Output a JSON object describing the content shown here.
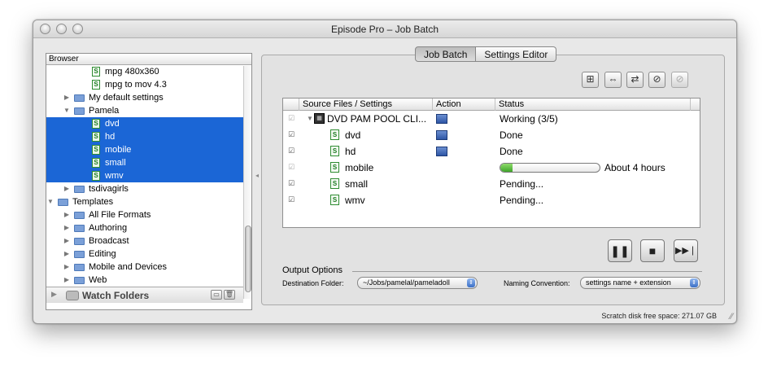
{
  "window": {
    "title": "Episode Pro – Job Batch"
  },
  "browser": {
    "header": "Browser",
    "items": [
      {
        "label": "mpg 480x360",
        "kind": "setting",
        "indent": 3,
        "selected": false
      },
      {
        "label": "mpg to mov 4.3",
        "kind": "setting",
        "indent": 3,
        "selected": false
      },
      {
        "label": "My default settings",
        "kind": "folder",
        "indent": 2,
        "open": false,
        "selected": false
      },
      {
        "label": "Pamela",
        "kind": "folder",
        "indent": 2,
        "open": true,
        "selected": false
      },
      {
        "label": "dvd",
        "kind": "setting",
        "indent": 3,
        "selected": true
      },
      {
        "label": "hd",
        "kind": "setting",
        "indent": 3,
        "selected": true
      },
      {
        "label": "mobile",
        "kind": "setting",
        "indent": 3,
        "selected": true
      },
      {
        "label": "small",
        "kind": "setting",
        "indent": 3,
        "selected": true
      },
      {
        "label": "wmv",
        "kind": "setting",
        "indent": 3,
        "selected": true
      },
      {
        "label": "tsdivagirls",
        "kind": "folder",
        "indent": 2,
        "open": false,
        "selected": false
      },
      {
        "label": "Templates",
        "kind": "folder",
        "indent": 1,
        "open": true,
        "selected": false
      },
      {
        "label": "All File Formats",
        "kind": "folder",
        "indent": 2,
        "open": false,
        "selected": false
      },
      {
        "label": "Authoring",
        "kind": "folder",
        "indent": 2,
        "open": false,
        "selected": false
      },
      {
        "label": "Broadcast",
        "kind": "folder",
        "indent": 2,
        "open": false,
        "selected": false
      },
      {
        "label": "Editing",
        "kind": "folder",
        "indent": 2,
        "open": false,
        "selected": false
      },
      {
        "label": "Mobile and Devices",
        "kind": "folder",
        "indent": 2,
        "open": false,
        "selected": false
      },
      {
        "label": "Web",
        "kind": "folder",
        "indent": 2,
        "open": false,
        "selected": false
      }
    ],
    "watch_folders": "Watch Folders"
  },
  "tabs": [
    {
      "label": "Job Batch",
      "active": true
    },
    {
      "label": "Settings Editor",
      "active": false
    }
  ],
  "toolbar": {
    "icons": [
      "add-job-icon",
      "link-icon",
      "swap-icon",
      "cancel-icon",
      "disabled-doc-icon"
    ]
  },
  "table": {
    "columns": [
      "Source Files / Settings",
      "Action",
      "Status"
    ],
    "rows": [
      {
        "name": "DVD PAM POOL CLI...",
        "kind": "batch",
        "checked": true,
        "dim": true,
        "status": "Working (3/5)",
        "has_action": true,
        "progress": null,
        "expanded": true
      },
      {
        "name": "dvd",
        "kind": "setting",
        "checked": true,
        "dim": false,
        "status": "Done",
        "has_action": true,
        "progress": null
      },
      {
        "name": "hd",
        "kind": "setting",
        "checked": true,
        "dim": false,
        "status": "Done",
        "has_action": true,
        "progress": null
      },
      {
        "name": "mobile",
        "kind": "setting",
        "checked": true,
        "dim": true,
        "status": "About 4 hours",
        "has_action": false,
        "progress": 0.12
      },
      {
        "name": "small",
        "kind": "setting",
        "checked": true,
        "dim": false,
        "status": "Pending...",
        "has_action": false,
        "progress": null
      },
      {
        "name": "wmv",
        "kind": "setting",
        "checked": true,
        "dim": false,
        "status": "Pending...",
        "has_action": false,
        "progress": null
      }
    ]
  },
  "transport": {
    "pause": "❚❚",
    "stop": "■",
    "skip": "▶▶❘"
  },
  "output_options": {
    "title": "Output Options",
    "destination_label": "Destination Folder:",
    "destination_value": "~/Jobs/pamelal/pameladoll",
    "naming_label": "Naming Convention:",
    "naming_value": "settings name + extension"
  },
  "statusbar": {
    "scratch": "Scratch disk free space: 271.07 GB"
  }
}
